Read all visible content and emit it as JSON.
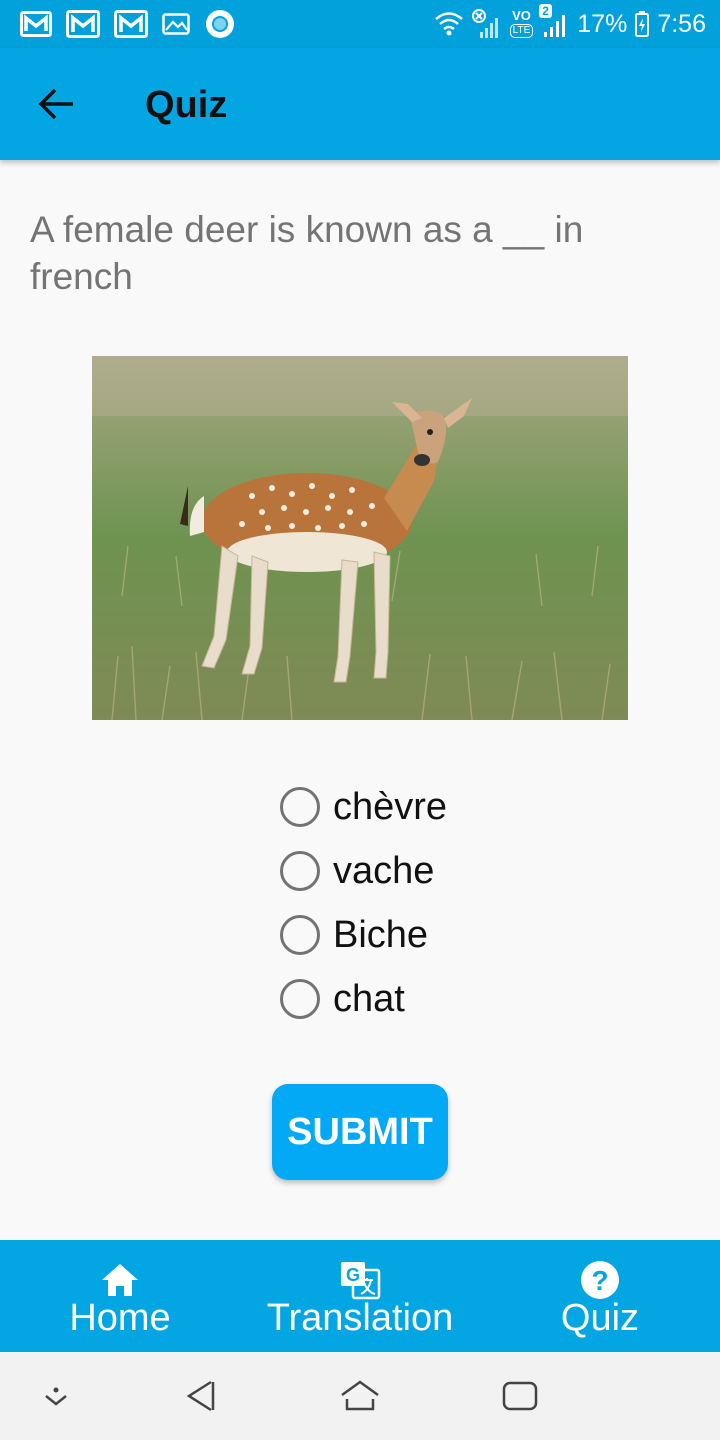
{
  "status_bar": {
    "battery": "17%",
    "time": "7:56",
    "sim_badge": "2",
    "volte": "VO",
    "lte": "LTE"
  },
  "app_bar": {
    "title": "Quiz"
  },
  "quiz": {
    "question": "A female deer is known as a __ in french",
    "options": [
      "chèvre",
      "vache",
      "Biche",
      "chat"
    ],
    "submit_label": "SUBMIT"
  },
  "bottom_nav": [
    {
      "label": "Home",
      "icon": "home-icon"
    },
    {
      "label": "Translation",
      "icon": "translate-icon"
    },
    {
      "label": "Quiz",
      "icon": "help-circle-icon"
    }
  ],
  "colors": {
    "primary": "#03a6e3",
    "status_bar": "#03a1dc",
    "button": "#03a9f4",
    "background": "#f9f9f9"
  }
}
